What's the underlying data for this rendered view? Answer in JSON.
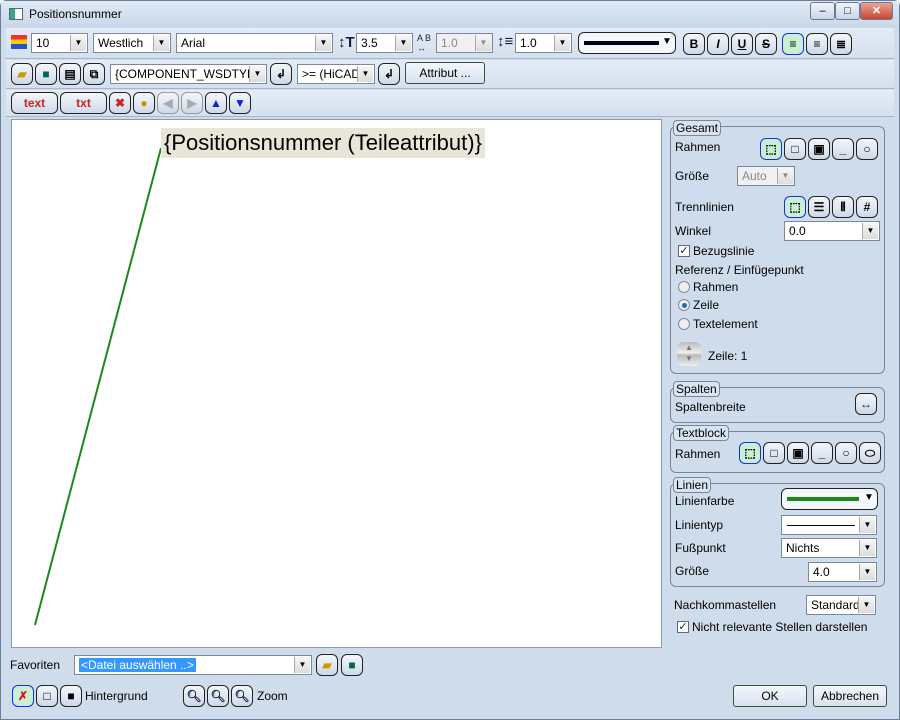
{
  "window": {
    "title": "Positionsnummer",
    "min": "–",
    "max": "□",
    "close": "✕"
  },
  "toolbar1": {
    "layer": "10",
    "style": "Westlich",
    "font": "Arial",
    "height": "3.5",
    "spacing": "1.0",
    "line_spacing": "1.0",
    "bold": "B",
    "italic": "I",
    "underline": "U",
    "strike": "S"
  },
  "toolbar2": {
    "attribute_combo": "{COMPONENT_WSDTYPE (Ar",
    "version_combo": ">= (HiCAD",
    "attribut_button": "Attribut ..."
  },
  "toolbar3": {
    "text_button": "text",
    "txt_button": "txt"
  },
  "canvas": {
    "text": "{Positionsnummer (Teileattribut)}",
    "leader_color": "#1a8a1a"
  },
  "gesamt": {
    "title": "Gesamt",
    "rahmen": "Rahmen",
    "groesse": "Größe",
    "groesse_value": "Auto",
    "trennlinien": "Trennlinien",
    "winkel": "Winkel",
    "winkel_value": "0.0",
    "bezugslinie": "Bezugslinie",
    "referenz": "Referenz / Einfügepunkt",
    "radio_rahmen": "Rahmen",
    "radio_zeile": "Zeile",
    "radio_textelement": "Textelement",
    "zeile": "Zeile: 1"
  },
  "spalten": {
    "title": "Spalten",
    "spaltenbreite": "Spaltenbreite"
  },
  "textblock": {
    "title": "Textblock",
    "rahmen": "Rahmen"
  },
  "linien": {
    "title": "Linien",
    "linienfarbe": "Linienfarbe",
    "linientyp": "Linientyp",
    "fusspunkt": "Fußpunkt",
    "fusspunkt_value": "Nichts",
    "groesse": "Größe",
    "groesse_value": "4.0"
  },
  "nachkomma": {
    "label": "Nachkommastellen",
    "value": "Standard",
    "nicht_relevante": "Nicht relevante Stellen darstellen"
  },
  "favoriten": {
    "label": "Favoriten",
    "value": "<Datei auswählen ..>"
  },
  "bottom": {
    "hintergrund": "Hintergrund",
    "zoom": "Zoom",
    "ok": "OK",
    "abbrechen": "Abbrechen"
  }
}
